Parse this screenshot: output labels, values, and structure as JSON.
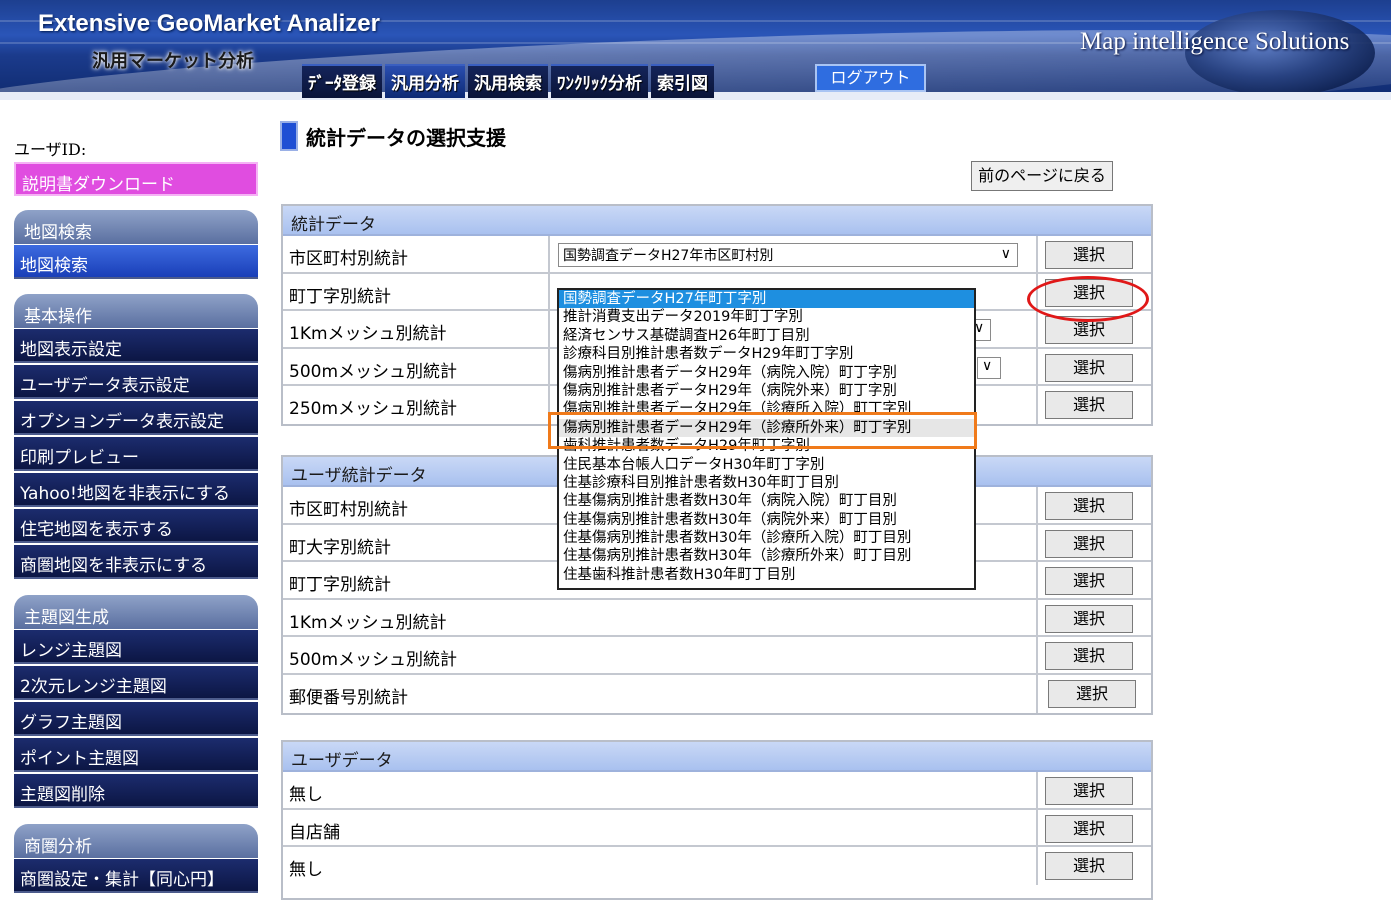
{
  "header": {
    "app_title": "Extensive GeoMarket Analizer",
    "app_subtitle": "汎用マーケット分析",
    "brand": "Map intelligence Solutions",
    "tabs": [
      {
        "label": "ﾃﾞｰﾀ登録",
        "active": false
      },
      {
        "label": "汎用分析",
        "active": true
      },
      {
        "label": "汎用検索",
        "active": false
      },
      {
        "label": "ﾜﾝｸﾘｯｸ分析",
        "active": false
      },
      {
        "label": "索引図",
        "active": false
      }
    ],
    "logout_label": "ログアウト"
  },
  "sidebar": {
    "user_id_label": "ユーザID:",
    "manual_download": "説明書ダウンロード",
    "sections": [
      {
        "title": "地図検索",
        "items": [
          {
            "label": "地図検索",
            "active": true
          }
        ]
      },
      {
        "title": "基本操作",
        "items": [
          {
            "label": "地図表示設定",
            "active": false
          },
          {
            "label": "ユーザデータ表示設定",
            "active": false
          },
          {
            "label": "オプションデータ表示設定",
            "active": false
          },
          {
            "label": "印刷プレビュー",
            "active": false
          },
          {
            "label": "Yahoo!地図を非表示にする",
            "active": false
          },
          {
            "label": "住宅地図を表示する",
            "active": false
          },
          {
            "label": "商圏地図を非表示にする",
            "active": false
          }
        ]
      },
      {
        "title": "主題図生成",
        "items": [
          {
            "label": "レンジ主題図",
            "active": false
          },
          {
            "label": "2次元レンジ主題図",
            "active": false
          },
          {
            "label": "グラフ主題図",
            "active": false
          },
          {
            "label": "ポイント主題図",
            "active": false
          },
          {
            "label": "主題図削除",
            "active": false
          }
        ]
      },
      {
        "title": "商圏分析",
        "items": [
          {
            "label": "商圏設定・集計【同心円】",
            "active": false
          }
        ]
      }
    ]
  },
  "main": {
    "page_title": "統計データの選択支援",
    "back_button": "前のページに戻る",
    "select_label": "選択",
    "stat_panel": {
      "title": "統計データ",
      "rows": [
        {
          "label": "市区町村別統計",
          "value": "国勢調査データH27年市区町村別"
        },
        {
          "label": "町丁字別統計",
          "value": ""
        },
        {
          "label": "1Kmメッシュ別統計",
          "value": ""
        },
        {
          "label": "500mメッシュ別統計",
          "value": ""
        },
        {
          "label": "250mメッシュ別統計",
          "value": ""
        }
      ]
    },
    "user_stat_panel": {
      "title": "ユーザ統計データ",
      "rows": [
        {
          "label": "市区町村別統計"
        },
        {
          "label": "町大字別統計"
        },
        {
          "label": "町丁字別統計"
        },
        {
          "label": "1Kmメッシュ別統計"
        },
        {
          "label": "500mメッシュ別統計"
        },
        {
          "label": "郵便番号別統計"
        }
      ]
    },
    "user_data_panel": {
      "title": "ユーザデータ",
      "rows": [
        {
          "label": "無し"
        },
        {
          "label": "自店舗"
        },
        {
          "label": "無し"
        }
      ]
    },
    "dropdown_options": [
      {
        "label": "国勢調査データH27年町丁字別",
        "state": "selected"
      },
      {
        "label": "推計消費支出データ2019年町丁字別",
        "state": ""
      },
      {
        "label": "経済センサス基礎調査H26年町丁目別",
        "state": ""
      },
      {
        "label": "診療科目別推計患者数データH29年町丁字別",
        "state": ""
      },
      {
        "label": "傷病別推計患者データH29年（病院入院）町丁字別",
        "state": ""
      },
      {
        "label": "傷病別推計患者データH29年（病院外来）町丁字別",
        "state": ""
      },
      {
        "label": "傷病別推計患者データH29年（診療所入院）町丁字別",
        "state": ""
      },
      {
        "label": "傷病別推計患者データH29年（診療所外来）町丁字別",
        "state": "hover"
      },
      {
        "label": "歯科推計患者数データH29年町丁字別",
        "state": ""
      },
      {
        "label": "住民基本台帳人口データH30年町丁字別",
        "state": ""
      },
      {
        "label": "住基診療科目別推計患者数H30年町丁目別",
        "state": ""
      },
      {
        "label": "住基傷病別推計患者数H30年（病院入院）町丁目別",
        "state": ""
      },
      {
        "label": "住基傷病別推計患者数H30年（病院外来）町丁目別",
        "state": ""
      },
      {
        "label": "住基傷病別推計患者数H30年（診療所入院）町丁目別",
        "state": ""
      },
      {
        "label": "住基傷病別推計患者数H30年（診療所外来）町丁目別",
        "state": ""
      },
      {
        "label": "住基歯科推計患者数H30年町丁目別",
        "state": ""
      }
    ],
    "annotation_colors": {
      "highlight_box": "#f07a1a",
      "circle": "#e01818"
    }
  }
}
